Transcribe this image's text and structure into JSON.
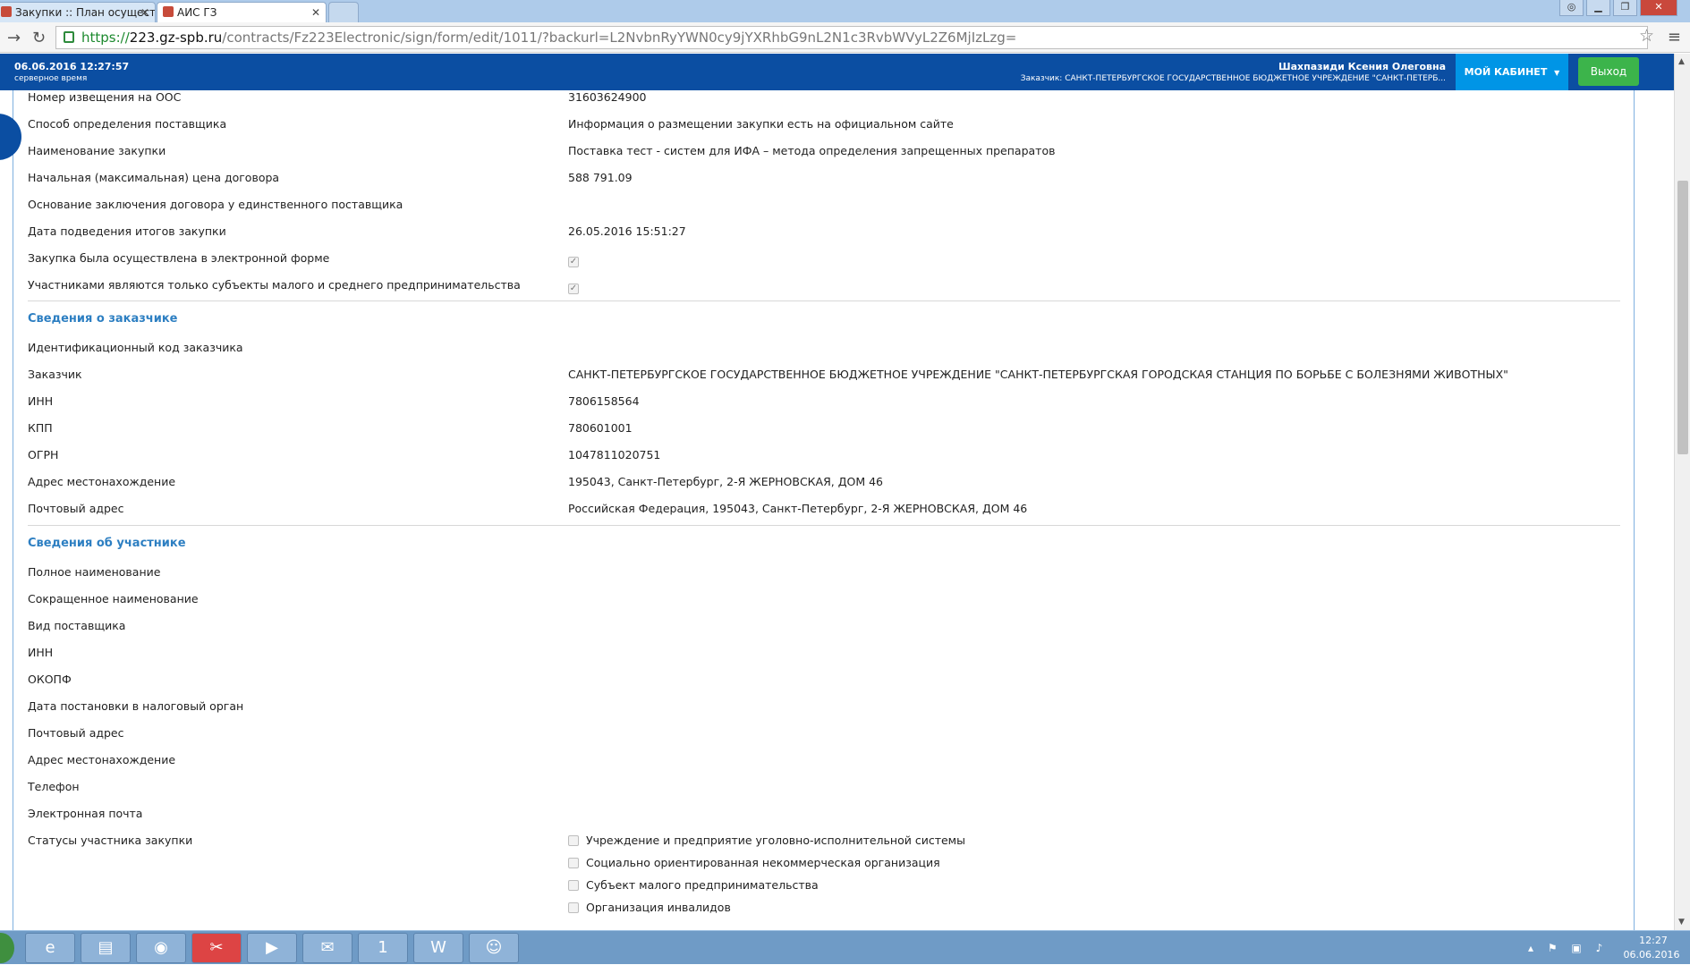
{
  "browser": {
    "tabs": [
      {
        "label": "Закупки :: План осуществл"
      },
      {
        "label": "АИС ГЗ"
      },
      {
        "label": ""
      }
    ],
    "url": {
      "scheme": "https://",
      "host": "223.gz-spb.ru",
      "path": "/contracts/Fz223Electronic/sign/form/edit/1011/?backurl=L2NvbnRyYWN0cy9jYXRhbG9nL2N1c3RvbWVyL2Z6MjIzLzg="
    }
  },
  "header": {
    "datetime": "06.06.2016 12:27:57",
    "datetime_caption": "серверное время",
    "user_name": "Шахпазиди Ксения Олеговна",
    "user_org": "Заказчик: САНКТ-ПЕТЕРБУРГСКОЕ ГОСУДАРСТВЕННОЕ БЮДЖЕТНОЕ УЧРЕЖДЕНИЕ \"САНКТ-ПЕТЕРБ...",
    "cabinet_label": "МОЙ КАБИНЕТ",
    "exit_label": "Выход",
    "colors": {
      "header_bg": "#0b4ea2",
      "cabinet_bg": "#0095e6",
      "exit_bg": "#3cb44b"
    }
  },
  "purchase": {
    "rows": [
      {
        "label": "Номер извещения на ООС",
        "value": "31603624900"
      },
      {
        "label": "Способ определения поставщика",
        "value": "Информация о размещении закупки есть на официальном сайте"
      },
      {
        "label": "Наименование закупки",
        "value": "Поставка тест - систем для ИФА – метода определения запрещенных препаратов"
      },
      {
        "label": "Начальная (максимальная) цена договора",
        "value": "588 791.09"
      },
      {
        "label": "Основание заключения договора у единственного поставщика",
        "value": ""
      },
      {
        "label": "Дата подведения итогов закупки",
        "value": "26.05.2016 15:51:27"
      }
    ],
    "checkbox_rows": [
      {
        "label": "Закупка была осуществлена в электронной форме",
        "checked": true
      },
      {
        "label": "Участниками являются только субъекты малого и среднего предпринимательства",
        "checked": true
      }
    ]
  },
  "customer": {
    "title": "Сведения о заказчике",
    "rows": [
      {
        "label": "Идентификационный код заказчика",
        "value": ""
      },
      {
        "label": "Заказчик",
        "value": "САНКТ-ПЕТЕРБУРГСКОЕ ГОСУДАРСТВЕННОЕ БЮДЖЕТНОЕ УЧРЕЖДЕНИЕ \"САНКТ-ПЕТЕРБУРГСКАЯ ГОРОДСКАЯ СТАНЦИЯ ПО БОРЬБЕ С БОЛЕЗНЯМИ ЖИВОТНЫХ\""
      },
      {
        "label": "ИНН",
        "value": "7806158564"
      },
      {
        "label": "КПП",
        "value": "780601001"
      },
      {
        "label": "ОГРН",
        "value": "1047811020751"
      },
      {
        "label": "Адрес местонахождение",
        "value": "195043, Санкт-Петербург, 2-Я ЖЕРНОВСКАЯ, ДОМ 46"
      },
      {
        "label": "Почтовый адрес",
        "value": "Российская Федерация, 195043, Санкт-Петербург, 2-Я ЖЕРНОВСКАЯ, ДОМ 46"
      }
    ]
  },
  "participant": {
    "title": "Сведения об участнике",
    "rows": [
      {
        "label": "Полное наименование"
      },
      {
        "label": "Сокращенное наименование"
      },
      {
        "label": "Вид поставщика"
      },
      {
        "label": "ИНН"
      },
      {
        "label": "ОКОПФ"
      },
      {
        "label": "Дата постановки в налоговый орган"
      },
      {
        "label": "Почтовый адрес"
      },
      {
        "label": "Адрес местонахождение"
      },
      {
        "label": "Телефон"
      },
      {
        "label": "Электронная почта"
      }
    ],
    "status_label": "Статусы участника закупки",
    "status_options": [
      {
        "label": "Учреждение и предприятие уголовно-исполнительной системы",
        "checked": false
      },
      {
        "label": "Социально ориентированная некоммерческая организация",
        "checked": false
      },
      {
        "label": "Субъект малого предпринимательства",
        "checked": false
      },
      {
        "label": "Организация инвалидов",
        "checked": false
      }
    ]
  },
  "taskbar": {
    "items": [
      {
        "icon": "internet-explorer-icon"
      },
      {
        "icon": "file-explorer-icon"
      },
      {
        "icon": "chrome-icon"
      },
      {
        "icon": "scissors-tool-icon"
      },
      {
        "icon": "media-player-icon"
      },
      {
        "icon": "mail-app-icon"
      },
      {
        "icon": "1c-icon"
      },
      {
        "icon": "word-icon"
      },
      {
        "icon": "graduate-app-icon"
      }
    ],
    "time": "12:27",
    "date": "06.06.2016"
  }
}
